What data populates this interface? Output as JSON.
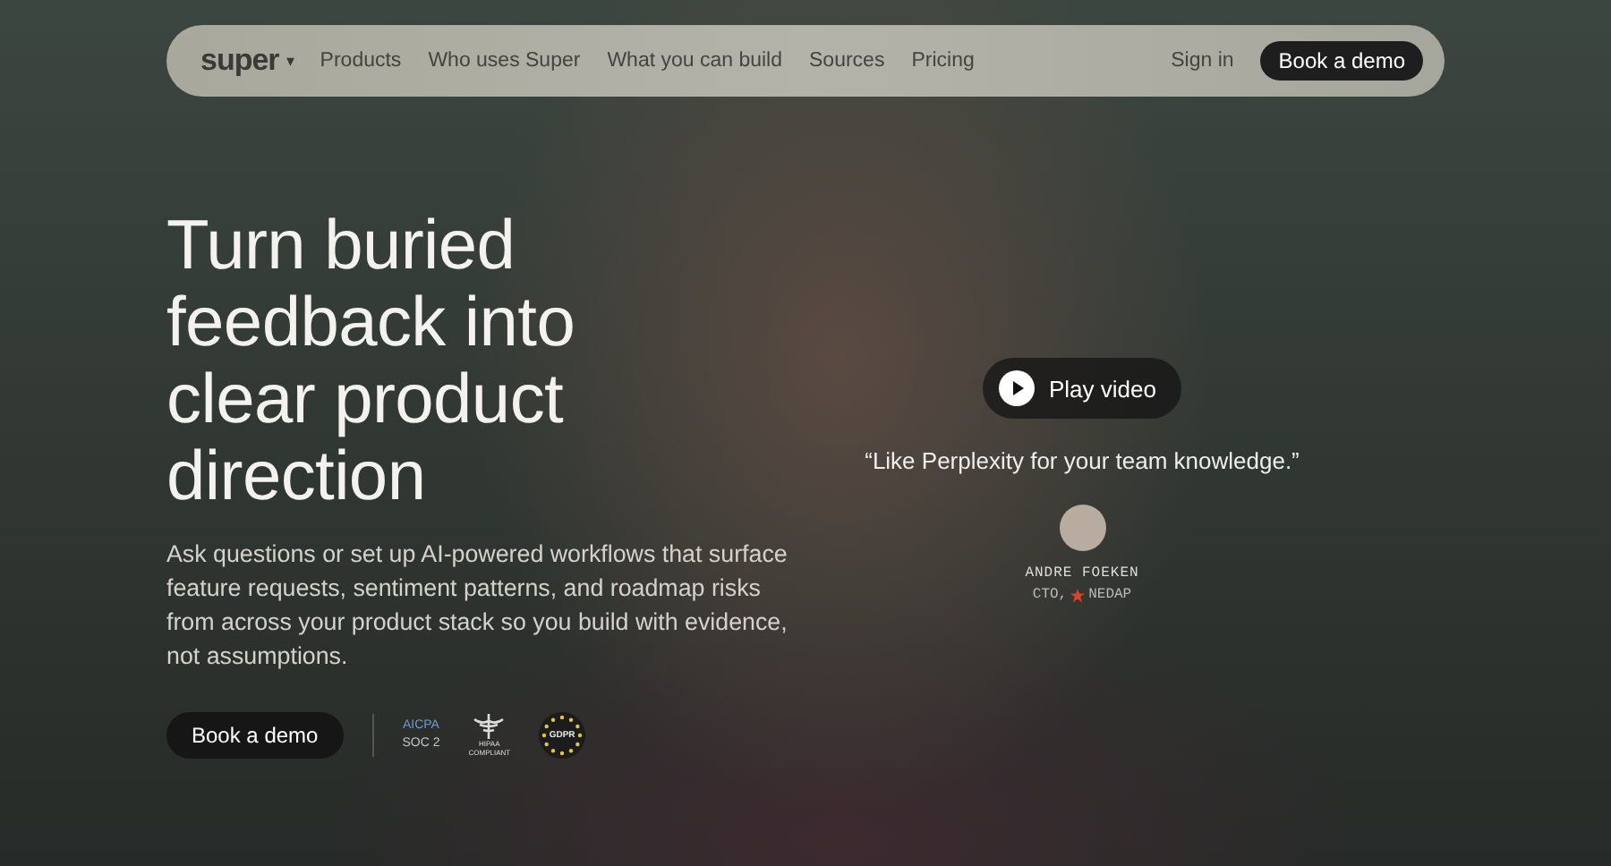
{
  "nav": {
    "logo": "super",
    "logo_caret": "▾",
    "links": [
      "Products",
      "Who uses Super",
      "What you can build",
      "Sources",
      "Pricing"
    ],
    "sign_in": "Sign in",
    "cta": "Book a demo"
  },
  "hero": {
    "headline": "Turn buried feedback into clear product direction",
    "body": "Ask questions or set up AI-powered workflows that surface feature requests, sentiment patterns, and roadmap risks from across your product stack so you build with evidence, not assumptions.",
    "cta": "Book a demo",
    "badges": [
      {
        "kind": "soc",
        "lines": [
          "AICPA",
          "SOC 2"
        ]
      },
      {
        "kind": "hipaa",
        "lines": [
          "HIPAA",
          "COMPLIANT"
        ]
      },
      {
        "kind": "gdpr",
        "lines": [
          "GDPR"
        ]
      }
    ]
  },
  "video": {
    "play": "Play video",
    "quote": "“Like Perplexity for your team knowledge.”",
    "name": "ANDRE FOEKEN",
    "role": "CTO,",
    "company": "NEDAP"
  }
}
